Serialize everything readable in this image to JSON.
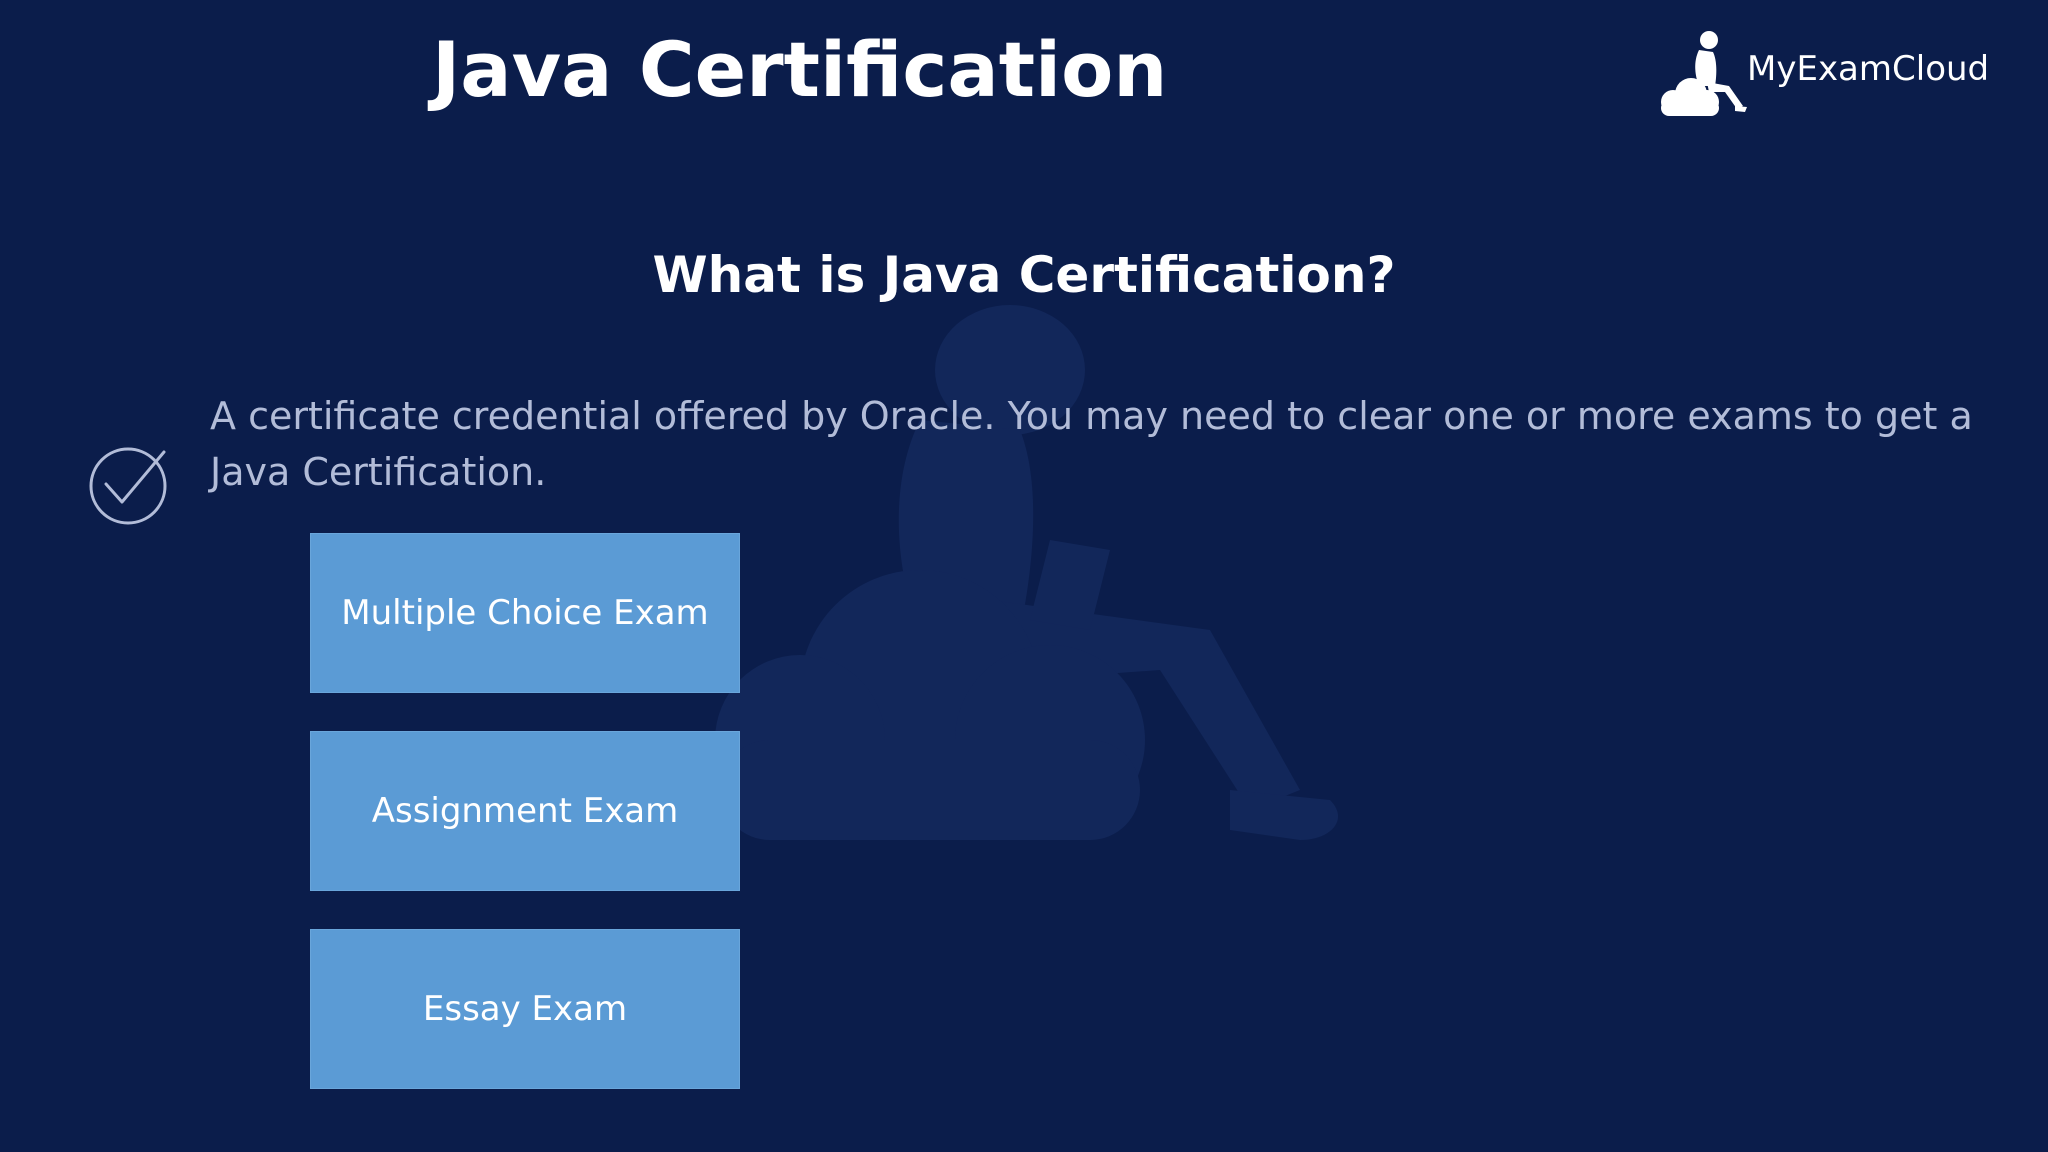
{
  "slide": {
    "title": "Java Certification",
    "subtitle": "What is Java Certification?",
    "description": "A certificate credential offered by Oracle. You may need to clear one or more exams to get a Java Certification."
  },
  "logo": {
    "text": "MyExamCloud",
    "icon": "person-on-cloud-icon"
  },
  "bullet_icon": "check-circle-icon",
  "exam_types": [
    {
      "label": "Multiple Choice Exam"
    },
    {
      "label": "Assignment Exam"
    },
    {
      "label": "Essay Exam"
    }
  ],
  "colors": {
    "background": "#0b1d4b",
    "button": "#5b9bd5",
    "text": "#ffffff",
    "description_text": "#b2bcd8"
  }
}
